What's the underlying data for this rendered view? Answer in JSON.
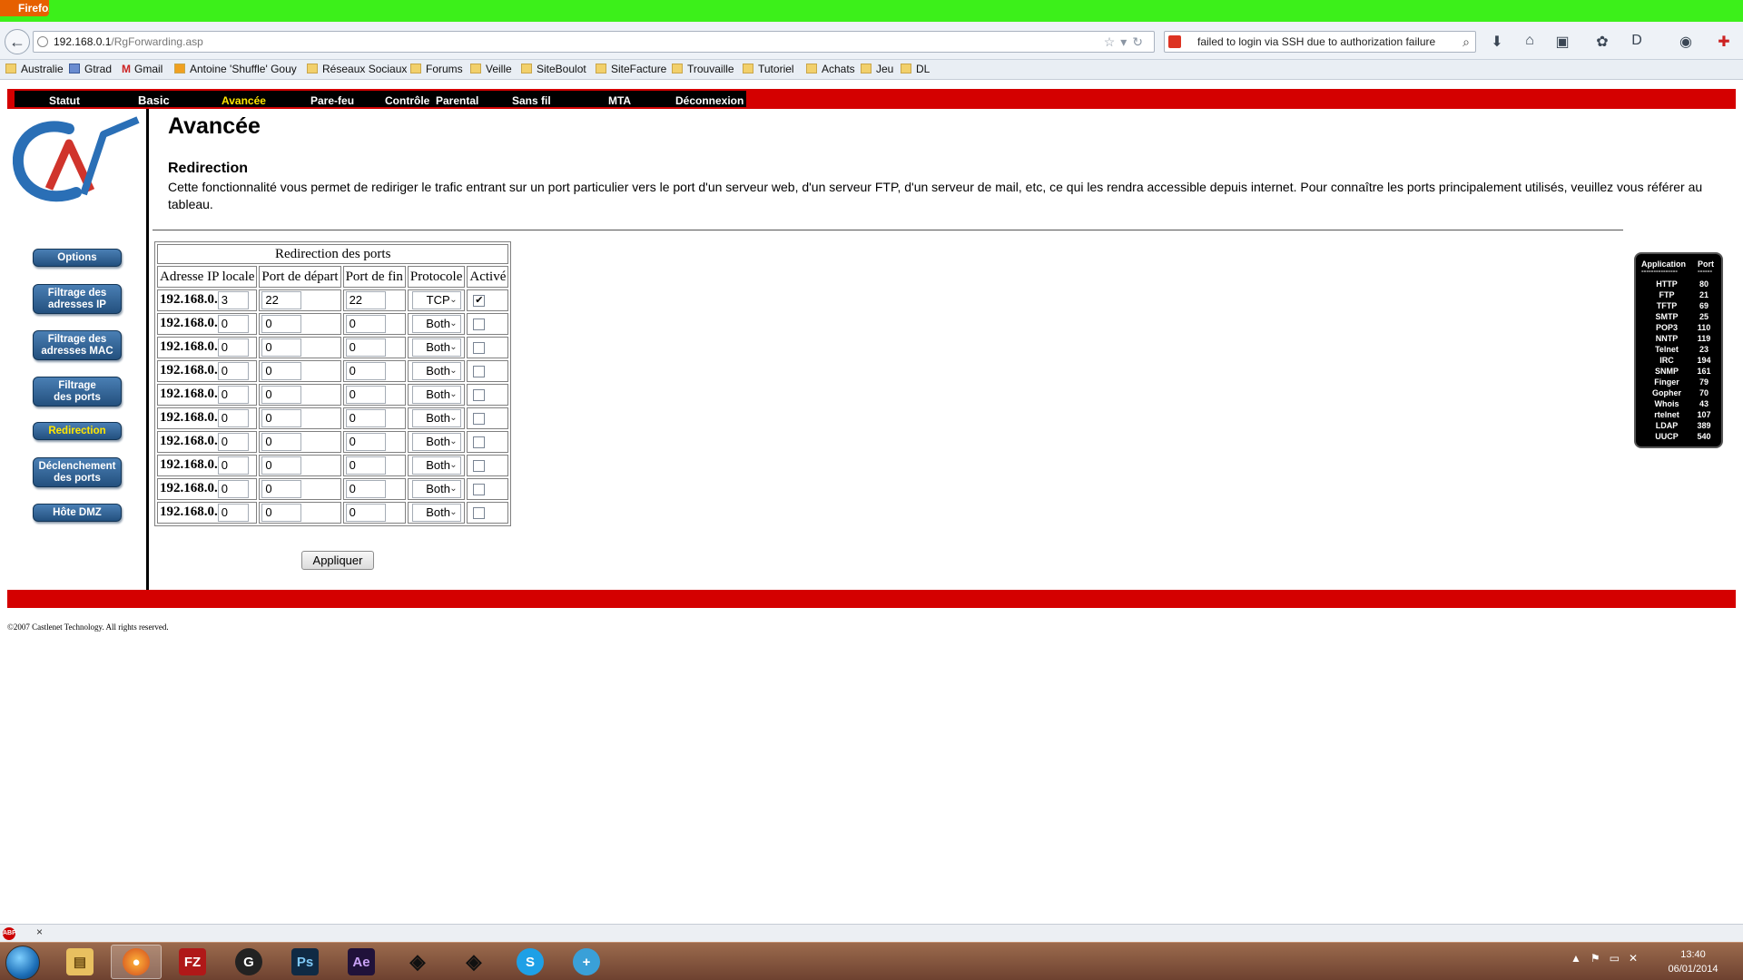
{
  "browser": {
    "app_button": "Firefox",
    "url_host": "192.168.0.1",
    "url_path": "/RgForwarding.asp",
    "search_text": "failed to login via SSH due to authorization failure",
    "bookmarks": [
      "Australie",
      "Gtrad",
      "Gmail",
      "Antoine 'Shuffle' Gouy",
      "Réseaux Sociaux",
      "Forums",
      "Veille",
      "SiteBoulot",
      "SiteFacture",
      "Trouvaille",
      "Tutoriel",
      "Achats",
      "Jeu",
      "DL"
    ]
  },
  "nav": {
    "items": [
      "Statut",
      "Basic",
      "Avancée",
      "Pare-feu",
      "Contrôle  Parental",
      "Sans fil",
      "MTA",
      "Déconnexion"
    ],
    "active": "Avancée"
  },
  "sidebar": {
    "options": "Options",
    "ip_filter_1": "Filtrage des",
    "ip_filter_2": "adresses IP",
    "mac_filter_1": "Filtrage des",
    "mac_filter_2": "adresses MAC",
    "port_filter_1": "Filtrage",
    "port_filter_2": "des ports",
    "redirection": "Redirection",
    "trigger_1": "Déclenchement",
    "trigger_2": "des ports",
    "dmz": "Hôte DMZ"
  },
  "main": {
    "title": "Avancée",
    "section_title": "Redirection",
    "description": "Cette fonctionnalité vous permet de rediriger le trafic entrant sur un port particulier vers le port d'un serveur web, d'un serveur FTP, d'un serveur de mail, etc, ce qui les rendra accessible depuis internet. Pour connaître les ports principalement utilisés, veuillez vous référer au tableau.",
    "apply_label": "Appliquer"
  },
  "forwarding_table": {
    "caption": "Redirection des ports",
    "headers": [
      "Adresse IP locale",
      "Port de départ",
      "Port de fin",
      "Protocole",
      "Activé"
    ],
    "ip_prefix": "192.168.0.",
    "rows": [
      {
        "ip_last": "3",
        "start": "22",
        "end": "22",
        "protocol": "TCP",
        "enabled": true
      },
      {
        "ip_last": "0",
        "start": "0",
        "end": "0",
        "protocol": "Both",
        "enabled": false
      },
      {
        "ip_last": "0",
        "start": "0",
        "end": "0",
        "protocol": "Both",
        "enabled": false
      },
      {
        "ip_last": "0",
        "start": "0",
        "end": "0",
        "protocol": "Both",
        "enabled": false
      },
      {
        "ip_last": "0",
        "start": "0",
        "end": "0",
        "protocol": "Both",
        "enabled": false
      },
      {
        "ip_last": "0",
        "start": "0",
        "end": "0",
        "protocol": "Both",
        "enabled": false
      },
      {
        "ip_last": "0",
        "start": "0",
        "end": "0",
        "protocol": "Both",
        "enabled": false
      },
      {
        "ip_last": "0",
        "start": "0",
        "end": "0",
        "protocol": "Both",
        "enabled": false
      },
      {
        "ip_last": "0",
        "start": "0",
        "end": "0",
        "protocol": "Both",
        "enabled": false
      },
      {
        "ip_last": "0",
        "start": "0",
        "end": "0",
        "protocol": "Both",
        "enabled": false
      }
    ]
  },
  "ports_reference": {
    "header_app": "Application",
    "header_port": "Port",
    "dashes_app": "---------------",
    "dashes_port": "------",
    "entries": [
      {
        "app": "HTTP",
        "port": "80"
      },
      {
        "app": "FTP",
        "port": "21"
      },
      {
        "app": "TFTP",
        "port": "69"
      },
      {
        "app": "SMTP",
        "port": "25"
      },
      {
        "app": "POP3",
        "port": "110"
      },
      {
        "app": "NNTP",
        "port": "119"
      },
      {
        "app": "Telnet",
        "port": "23"
      },
      {
        "app": "IRC",
        "port": "194"
      },
      {
        "app": "SNMP",
        "port": "161"
      },
      {
        "app": "Finger",
        "port": "79"
      },
      {
        "app": "Gopher",
        "port": "70"
      },
      {
        "app": "Whois",
        "port": "43"
      },
      {
        "app": "rtelnet",
        "port": "107"
      },
      {
        "app": "LDAP",
        "port": "389"
      },
      {
        "app": "UUCP",
        "port": "540"
      }
    ]
  },
  "footer": {
    "copyright": "©2007 Castlenet Technology. All rights reserved."
  },
  "taskbar": {
    "apps": [
      "explorer-icon",
      "firefox-icon",
      "filezilla-icon",
      "sourcetree-icon",
      "photoshop-icon",
      "after-effects-icon",
      "unity-icon",
      "unity-icon",
      "skype-icon",
      "app-icon"
    ],
    "time": "13:40",
    "date": "06/01/2014"
  },
  "colors": {
    "nav_red": "#d40000",
    "nav_active": "#ffe600",
    "sidebar_blue": "#23507e",
    "titlebar_green": "#3cf01a"
  }
}
